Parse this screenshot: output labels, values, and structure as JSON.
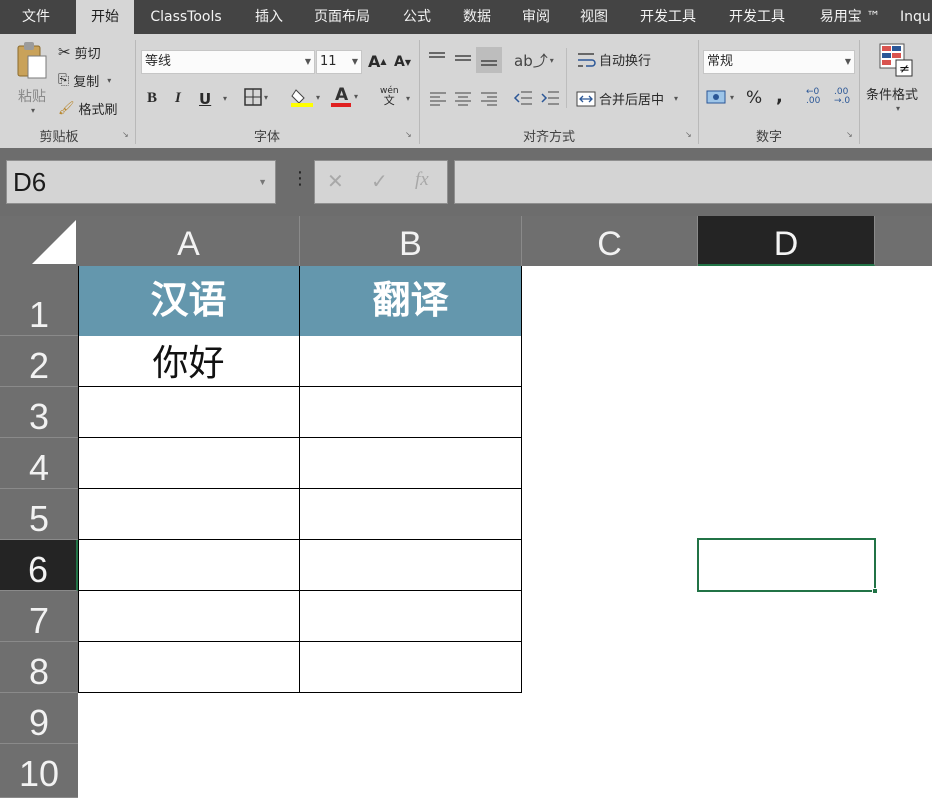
{
  "tabs": [
    {
      "label": "文件",
      "active": false
    },
    {
      "label": "开始",
      "active": true
    },
    {
      "label": "ClassTools",
      "active": false
    },
    {
      "label": "插入",
      "active": false
    },
    {
      "label": "页面布局",
      "active": false
    },
    {
      "label": "公式",
      "active": false
    },
    {
      "label": "数据",
      "active": false
    },
    {
      "label": "审阅",
      "active": false
    },
    {
      "label": "视图",
      "active": false
    },
    {
      "label": "开发工具",
      "active": false
    },
    {
      "label": "开发工具",
      "active": false
    },
    {
      "label": "易用宝 ™",
      "active": false
    },
    {
      "label": "Inqu",
      "active": false
    }
  ],
  "ribbon": {
    "clipboard": {
      "paste": "粘贴",
      "cut": "剪切",
      "copy": "复制",
      "format_painter": "格式刷",
      "label": "剪贴板"
    },
    "font": {
      "name": "等线",
      "size": "11",
      "label": "字体",
      "bold": "B",
      "italic": "I",
      "underline": "U",
      "phonetic": "wén"
    },
    "alignment": {
      "wrap_text": "自动换行",
      "merge_center": "合并后居中",
      "label": "对齐方式"
    },
    "number": {
      "format": "常规",
      "percent": "%",
      "comma": ",",
      "label": "数字",
      "inc_decimal": "←0\n.00",
      "dec_decimal": ".00\n→.0"
    },
    "styles": {
      "conditional_format": "条件格式"
    }
  },
  "formula_bar": {
    "name_box": "D6",
    "cancel": "✕",
    "enter": "✓",
    "fx": "fx",
    "value": ""
  },
  "sheet": {
    "columns": [
      "A",
      "B",
      "C",
      "D"
    ],
    "rows": [
      "1",
      "2",
      "3",
      "4",
      "5",
      "6",
      "7",
      "8",
      "9",
      "10"
    ],
    "selected_column": "D",
    "selected_row": "6",
    "header_row": [
      "汉语",
      "翻译"
    ],
    "data": [
      [
        "你好",
        ""
      ],
      [
        "",
        ""
      ],
      [
        "",
        ""
      ],
      [
        "",
        ""
      ],
      [
        "",
        ""
      ],
      [
        "",
        ""
      ],
      [
        "",
        ""
      ]
    ]
  },
  "colors": {
    "header_fill": "#6497ad",
    "selection": "#217346",
    "ribbon_bg": "#d6d6d6",
    "tabbar_bg": "#444444"
  }
}
